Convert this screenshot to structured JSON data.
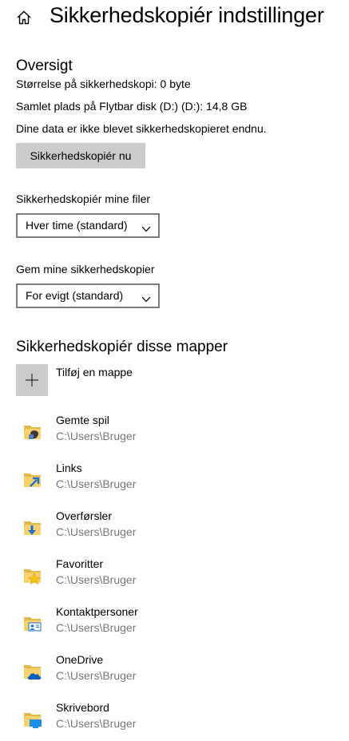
{
  "header": {
    "title": "Sikkerhedskopiér indstillinger",
    "home_icon": "home-icon"
  },
  "overview": {
    "title": "Oversigt",
    "backup_size": "Størrelse på sikkerhedskopi: 0 byte",
    "total_space": "Samlet plads på Flytbar disk (D:) (D:): 14,8 GB",
    "status": "Dine data er ikke blevet sikkerhedskopieret endnu.",
    "backup_now_label": "Sikkerhedskopiér nu"
  },
  "frequency": {
    "label": "Sikkerhedskopiér mine filer",
    "value": "Hver time (standard)"
  },
  "retention": {
    "label": "Gem mine sikkerhedskopier",
    "value": "For evigt (standard)"
  },
  "folders_section": {
    "title": "Sikkerhedskopiér disse mapper",
    "add_label": "Tilføj en mappe",
    "items": [
      {
        "name": "Gemte spil",
        "path": "C:\\Users\\Bruger",
        "icon": "saved-games-folder-icon"
      },
      {
        "name": "Links",
        "path": "C:\\Users\\Bruger",
        "icon": "links-folder-icon"
      },
      {
        "name": "Overførsler",
        "path": "C:\\Users\\Bruger",
        "icon": "downloads-folder-icon"
      },
      {
        "name": "Favoritter",
        "path": "C:\\Users\\Bruger",
        "icon": "favorites-folder-icon"
      },
      {
        "name": "Kontaktpersoner",
        "path": "C:\\Users\\Bruger",
        "icon": "contacts-folder-icon"
      },
      {
        "name": "OneDrive",
        "path": "C:\\Users\\Bruger",
        "icon": "onedrive-folder-icon"
      },
      {
        "name": "Skrivebord",
        "path": "C:\\Users\\Bruger",
        "icon": "desktop-folder-icon"
      }
    ]
  }
}
